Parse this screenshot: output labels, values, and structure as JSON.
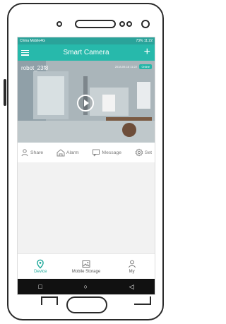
{
  "status": {
    "carrier": "China Mobile4G",
    "right": "73% 11:22"
  },
  "header": {
    "title": "Smart Camera"
  },
  "camera": {
    "name": "robot_23f8",
    "timestamp": "2018-09-18 11:22",
    "online_badge": "Online"
  },
  "actions": [
    {
      "label": "Share",
      "icon": "person-share-icon"
    },
    {
      "label": "Alarm",
      "icon": "home-alarm-icon"
    },
    {
      "label": "Message",
      "icon": "message-icon"
    },
    {
      "label": "Set",
      "icon": "gear-icon"
    }
  ],
  "tabs": [
    {
      "label": "Device",
      "icon": "location-pin-icon",
      "active": true
    },
    {
      "label": "Mobile Storage",
      "icon": "image-icon",
      "active": false
    },
    {
      "label": "My",
      "icon": "person-icon",
      "active": false
    }
  ],
  "colors": {
    "accent": "#27b9ab",
    "status_bar": "#2aa39a",
    "navbar": "#111111"
  }
}
